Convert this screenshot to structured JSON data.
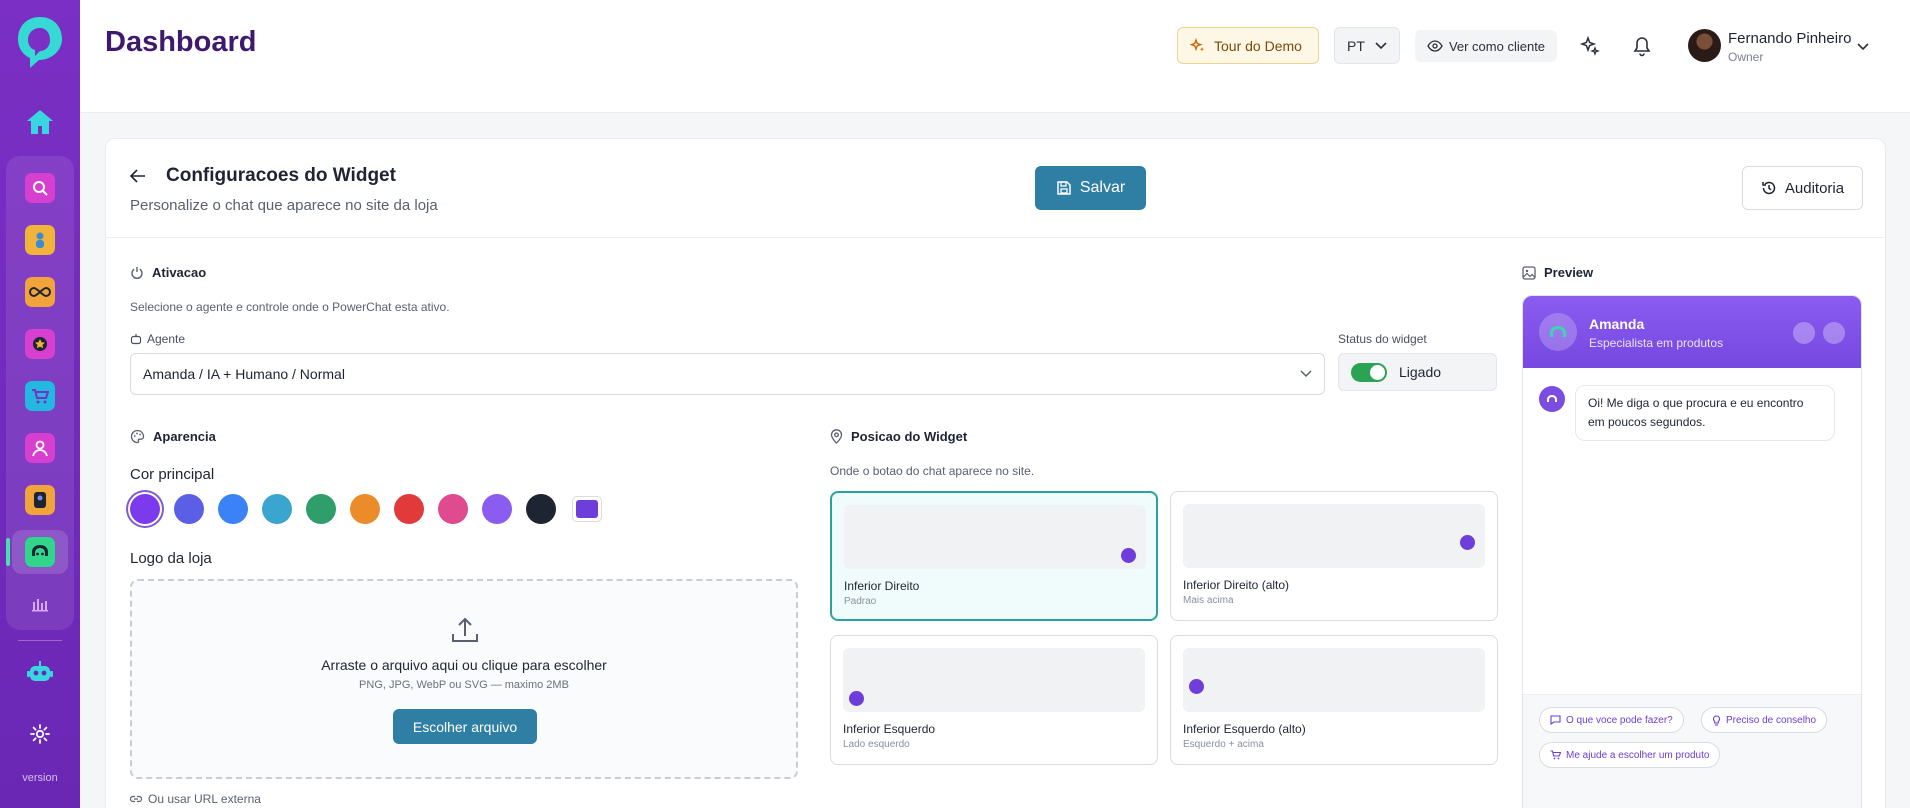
{
  "colors": {
    "sidebar": "#7b2fc4",
    "accent": "#6d3ed9",
    "primary_btn": "#2f7ea3",
    "success": "#2aa354"
  },
  "sidebar": {
    "version": "version"
  },
  "topbar": {
    "title": "Dashboard",
    "tour_label": "Tour do Demo",
    "lang_label": "PT",
    "client_label": "Ver como cliente",
    "user_name": "Fernando Pinheiro",
    "user_role": "Owner"
  },
  "header": {
    "title": "Configuracoes do Widget",
    "subtitle": "Personalize o chat que aparece no site da loja",
    "save_label": "Salvar",
    "audit_label": "Auditoria"
  },
  "activation": {
    "title": "Ativacao",
    "desc": "Selecione o agente e controle onde o PowerChat esta ativo.",
    "agent_label": "Agente",
    "agent_value": "Amanda / IA + Humano / Normal",
    "status_label": "Status do widget",
    "status_value": "Ligado"
  },
  "appearance": {
    "title": "Aparencia",
    "color_label": "Cor principal",
    "swatches": [
      "#7c3aed",
      "#5b5fe6",
      "#3b82f6",
      "#3aa6cf",
      "#2f9e6a",
      "#ec8b2a",
      "#e03a3a",
      "#e04a8e",
      "#8b5cf0",
      "#1f2433"
    ],
    "custom_swatch": "#6d3ed9",
    "logo_label": "Logo da loja",
    "upload_title": "Arraste o arquivo aqui ou clique para escolher",
    "upload_sub": "PNG, JPG, WebP ou SVG — maximo 2MB",
    "upload_btn": "Escolher arquivo",
    "url_alt": "Ou usar URL externa"
  },
  "position": {
    "title": "Posicao do Widget",
    "desc": "Onde o botao do chat aparece no site.",
    "options": [
      {
        "name": "Inferior Direito",
        "sub": "Padrao"
      },
      {
        "name": "Inferior Direito (alto)",
        "sub": "Mais acima"
      },
      {
        "name": "Inferior Esquerdo",
        "sub": "Lado esquerdo"
      },
      {
        "name": "Inferior Esquerdo (alto)",
        "sub": "Esquerdo + acima"
      }
    ]
  },
  "preview": {
    "title": "Preview",
    "agent_name": "Amanda",
    "agent_role": "Especialista em produtos",
    "message": "Oi! Me diga o que procura e eu encontro em poucos segundos.",
    "chips": [
      "O que voce pode fazer?",
      "Preciso de conselho",
      "Me ajude a escolher um produto"
    ]
  }
}
